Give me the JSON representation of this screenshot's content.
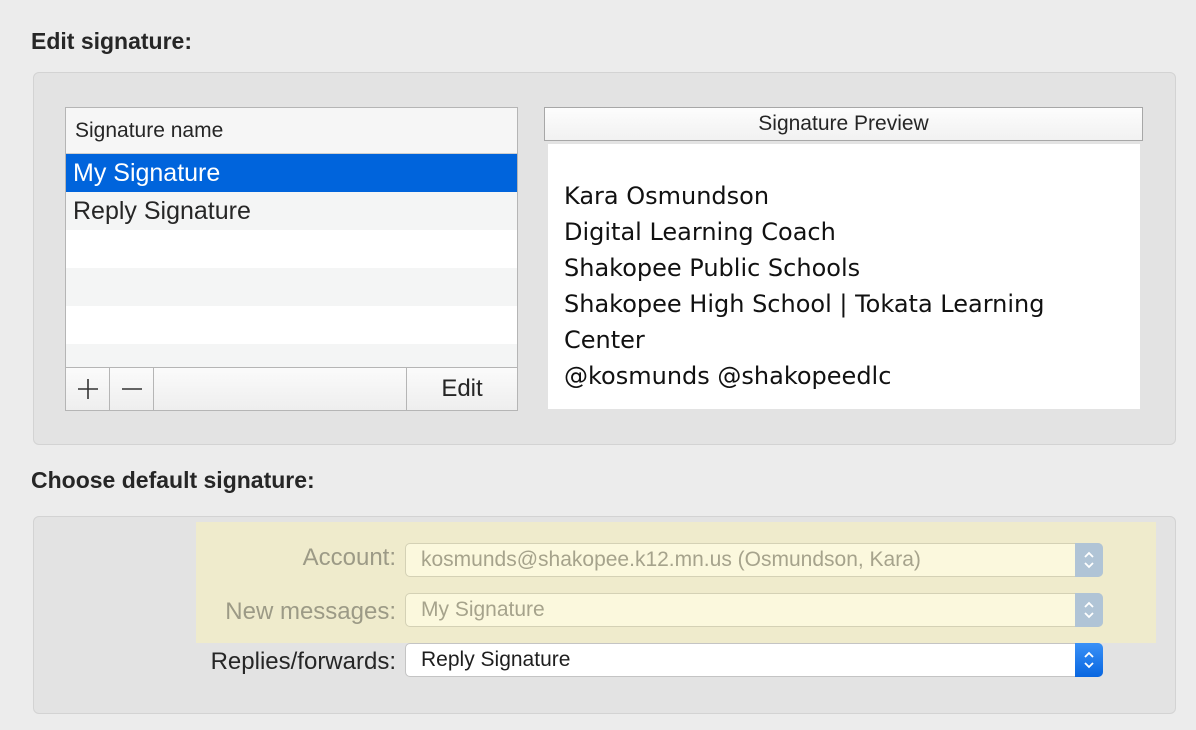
{
  "edit_section": {
    "title": "Edit signature:",
    "table_header": "Signature name",
    "signatures": [
      {
        "name": "My Signature",
        "selected": true
      },
      {
        "name": "Reply Signature",
        "selected": false
      }
    ],
    "add_label": "+",
    "remove_label": "−",
    "edit_label": "Edit",
    "preview_header": "Signature Preview",
    "preview_lines": [
      "Kara Osmundson",
      "Digital Learning Coach",
      "Shakopee Public Schools",
      "Shakopee High School | Tokata Learning",
      "Center",
      "@kosmunds @shakopeedlc"
    ]
  },
  "default_section": {
    "title": "Choose default signature:",
    "account_label": "Account:",
    "account_value": "kosmunds@shakopee.k12.mn.us (Osmundson, Kara)",
    "new_messages_label": "New messages:",
    "new_messages_value": "My Signature",
    "replies_label": "Replies/forwards:",
    "replies_value": "Reply Signature"
  },
  "colors": {
    "selection": "#0064dc",
    "highlight": "#efebcc",
    "popup_accent": "#0866e0"
  }
}
